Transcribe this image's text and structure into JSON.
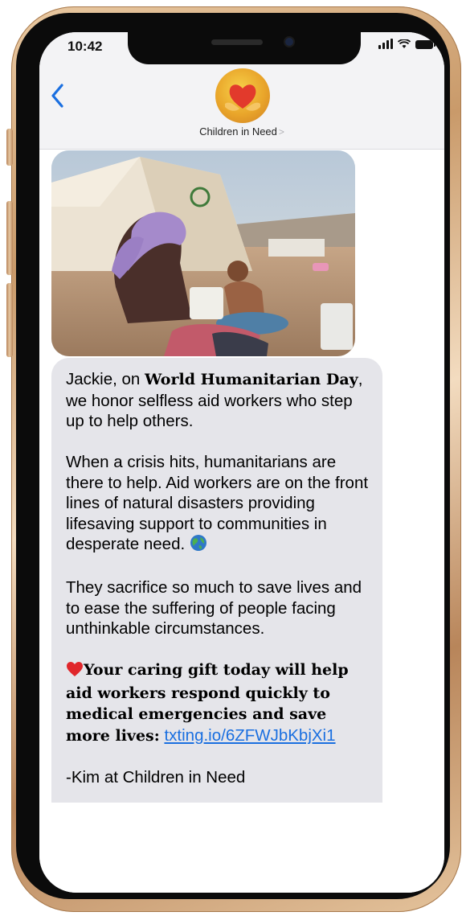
{
  "status_bar": {
    "time": "10:42"
  },
  "header": {
    "contact_name": "Children in Need",
    "contact_chevron": ">"
  },
  "icons": {
    "back": "chevron-left-icon",
    "avatar": "heart-hands-logo",
    "emoji_globe": "globe-icon",
    "emoji_heart": "red-heart-icon"
  },
  "colors": {
    "accent": "#1a6fe0",
    "bubble_bg": "#e5e5ea",
    "frame_gold": "#d8b07f"
  },
  "message": {
    "p1_part1": "Jackie, on ",
    "p1_bold": "World Humanitarian Day",
    "p1_part2": ", we honor selfless aid workers who step up to help others.",
    "p2": "When a crisis hits, humanitarians are there to help. Aid workers are on the front lines of natural disasters providing lifesaving support to communities in desperate need.",
    "p3": "They sacrifice so much to save lives and to ease the suffering of people facing unthinkable circumstances.",
    "p4_bold": "Your caring gift today will help aid workers respond quickly to medical emergencies and save more lives:",
    "p4_link": "txting.io/6ZFWJbKbjXi1",
    "signature": "-Kim at Children in Need"
  }
}
